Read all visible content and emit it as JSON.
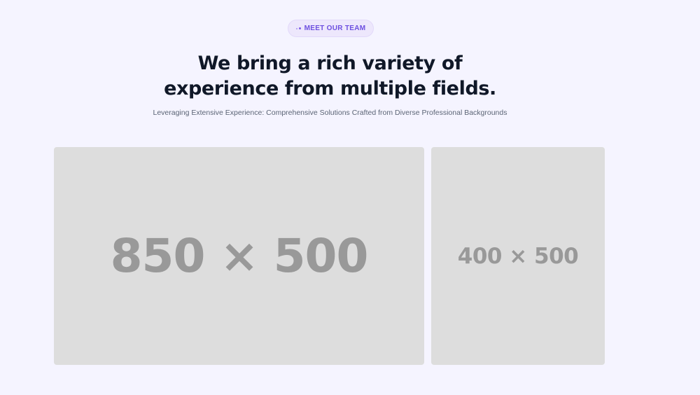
{
  "badge": {
    "label": "MEET OUR TEAM",
    "icon": "sparkle-dots-icon"
  },
  "headline": {
    "line1": "We bring a rich variety of",
    "line2": "experience from multiple fields."
  },
  "subtitle": "Leveraging Extensive Experience: Comprehensive Solutions Crafted from Diverse Professional Backgrounds",
  "images": {
    "large_label": "850 × 500",
    "small_label": "400 × 500"
  },
  "colors": {
    "background": "#f5f4ff",
    "accent": "#6d4fe0",
    "heading": "#101828",
    "placeholder_bg": "#dddddd",
    "placeholder_text": "#999999"
  }
}
